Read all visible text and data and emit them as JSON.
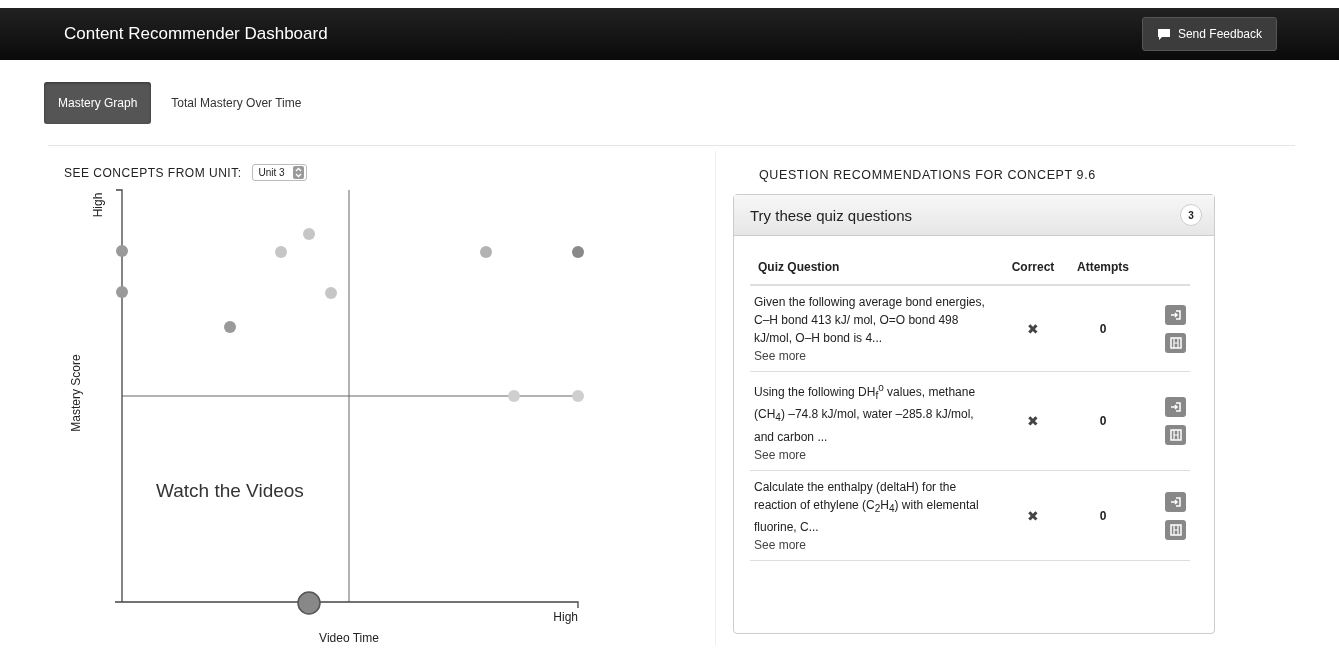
{
  "header": {
    "title": "Content Recommender Dashboard",
    "feedback_button": "Send Feedback"
  },
  "tabs": [
    {
      "label": "Mastery Graph",
      "selected": true
    },
    {
      "label": "Total Mastery Over Time",
      "selected": false
    }
  ],
  "unit_filter": {
    "label": "SEE CONCEPTS FROM UNIT:",
    "value": "Unit 3"
  },
  "graph": {
    "y_axis_label": "Mastery Score",
    "y_high_label": "High",
    "x_axis_label": "Video Time",
    "x_high_label": "High",
    "quadrant_label": "Watch the Videos"
  },
  "recommendations": {
    "heading": "QUESTION RECOMMENDATIONS FOR CONCEPT 9.6",
    "panel_title": "Try these quiz questions",
    "count": "3",
    "columns": [
      "Quiz Question",
      "Correct",
      "Attempts"
    ],
    "rows": [
      {
        "question": "Given the following average bond energies, C–H bond 413 kJ/ mol, O=O bond 498 kJ/mol, O–H bond is 4...",
        "link": "See more",
        "correct": "✖",
        "attempts": "0"
      },
      {
        "question": "Using the following DH$_{f}$$^{o}$ values, methane (CH$_{4}$) –74.8 kJ/mol, water –285.8 kJ/mol, and carbon ...",
        "link": "See more",
        "correct": "✖",
        "attempts": "0"
      },
      {
        "question": "Calculate the enthalpy (deltaH) for the reaction of ethylene (C$_{2}$H$_{4}$) with elemental fluorine, C...",
        "link": "See more",
        "correct": "✖",
        "attempts": "0"
      }
    ]
  }
}
